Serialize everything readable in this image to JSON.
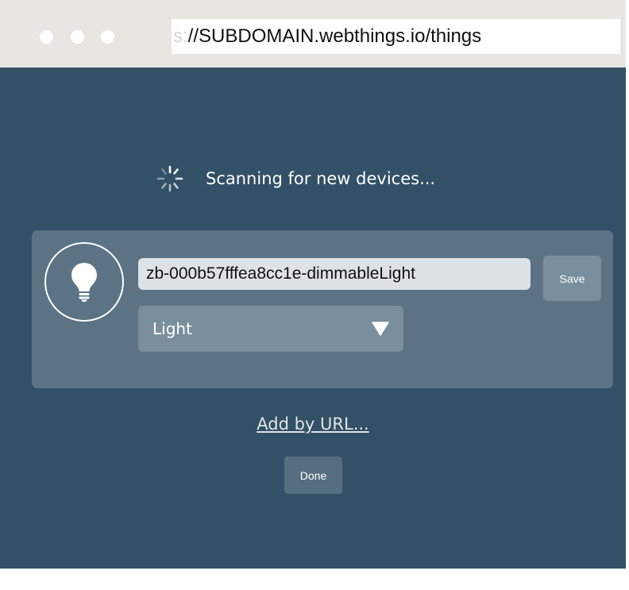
{
  "browser": {
    "url_faded": "s:",
    "url": "//SUBDOMAIN.webthings.io/things",
    "window_dots": [
      "close",
      "minimize",
      "maximize"
    ]
  },
  "scan": {
    "status_text": "Scanning for new devices..."
  },
  "device": {
    "icon": "lightbulb-icon",
    "name_value": "zb-000b57fffea8cc1e-dimmableLight",
    "save_label": "Save",
    "type_selected": "Light",
    "type_dropdown_icon": "chevron-down-icon"
  },
  "actions": {
    "add_by_url_label": "Add by URL...",
    "done_label": "Done"
  },
  "colors": {
    "background": "#325066",
    "card": "#5b7384",
    "button": "#7a8f9d",
    "chrome": "#e8e6e1"
  }
}
